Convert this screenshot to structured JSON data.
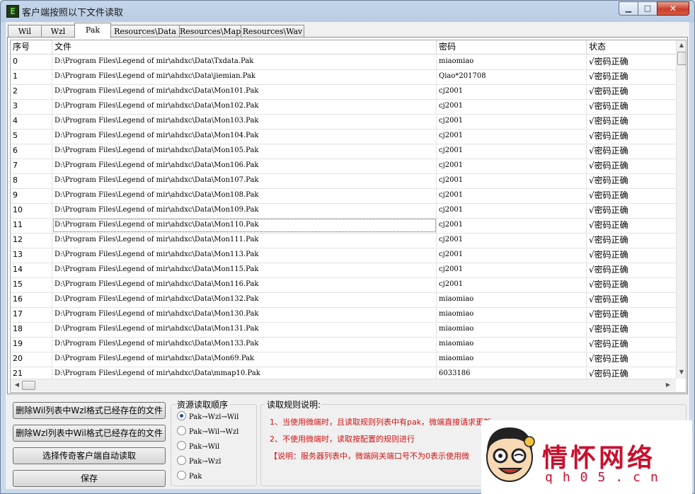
{
  "window": {
    "title": "客户端按照以下文件读取",
    "icon_letter": "E",
    "min_glyph": "▁",
    "max_glyph": "□",
    "close_glyph": "✕"
  },
  "tabs": [
    {
      "label": "Wil",
      "active": false
    },
    {
      "label": "Wzl",
      "active": false
    },
    {
      "label": "Pak",
      "active": true
    },
    {
      "label": "Resources\\Data",
      "active": false
    },
    {
      "label": "Resources\\Map",
      "active": false
    },
    {
      "label": "Resources\\Wav",
      "active": false
    }
  ],
  "table": {
    "columns": [
      "序号",
      "文件",
      "密码",
      "状态"
    ],
    "rows": [
      {
        "no": "0",
        "file": "D:\\Program Files\\Legend of mir\\ahdxc\\Data\\Txdata.Pak",
        "pwd": "miaomiao",
        "status": "√密码正确"
      },
      {
        "no": "1",
        "file": "D:\\Program Files\\Legend of mir\\ahdxc\\Data\\jiemian.Pak",
        "pwd": "Qiao*201708",
        "status": "√密码正确"
      },
      {
        "no": "2",
        "file": "D:\\Program Files\\Legend of mir\\ahdxc\\Data\\Mon101.Pak",
        "pwd": "cj2001",
        "status": "√密码正确"
      },
      {
        "no": "3",
        "file": "D:\\Program Files\\Legend of mir\\ahdxc\\Data\\Mon102.Pak",
        "pwd": "cj2001",
        "status": "√密码正确"
      },
      {
        "no": "4",
        "file": "D:\\Program Files\\Legend of mir\\ahdxc\\Data\\Mon103.Pak",
        "pwd": "cj2001",
        "status": "√密码正确"
      },
      {
        "no": "5",
        "file": "D:\\Program Files\\Legend of mir\\ahdxc\\Data\\Mon104.Pak",
        "pwd": "cj2001",
        "status": "√密码正确"
      },
      {
        "no": "6",
        "file": "D:\\Program Files\\Legend of mir\\ahdxc\\Data\\Mon105.Pak",
        "pwd": "cj2001",
        "status": "√密码正确"
      },
      {
        "no": "7",
        "file": "D:\\Program Files\\Legend of mir\\ahdxc\\Data\\Mon106.Pak",
        "pwd": "cj2001",
        "status": "√密码正确"
      },
      {
        "no": "8",
        "file": "D:\\Program Files\\Legend of mir\\ahdxc\\Data\\Mon107.Pak",
        "pwd": "cj2001",
        "status": "√密码正确"
      },
      {
        "no": "9",
        "file": "D:\\Program Files\\Legend of mir\\ahdxc\\Data\\Mon108.Pak",
        "pwd": "cj2001",
        "status": "√密码正确"
      },
      {
        "no": "10",
        "file": "D:\\Program Files\\Legend of mir\\ahdxc\\Data\\Mon109.Pak",
        "pwd": "cj2001",
        "status": "√密码正确"
      },
      {
        "no": "11",
        "file": "D:\\Program Files\\Legend of mir\\ahdxc\\Data\\Mon110.Pak",
        "pwd": "cj2001",
        "status": "√密码正确",
        "selected": true
      },
      {
        "no": "12",
        "file": "D:\\Program Files\\Legend of mir\\ahdxc\\Data\\Mon111.Pak",
        "pwd": "cj2001",
        "status": "√密码正确"
      },
      {
        "no": "13",
        "file": "D:\\Program Files\\Legend of mir\\ahdxc\\Data\\Mon113.Pak",
        "pwd": "cj2001",
        "status": "√密码正确"
      },
      {
        "no": "14",
        "file": "D:\\Program Files\\Legend of mir\\ahdxc\\Data\\Mon115.Pak",
        "pwd": "cj2001",
        "status": "√密码正确"
      },
      {
        "no": "15",
        "file": "D:\\Program Files\\Legend of mir\\ahdxc\\Data\\Mon116.Pak",
        "pwd": "cj2001",
        "status": "√密码正确"
      },
      {
        "no": "16",
        "file": "D:\\Program Files\\Legend of mir\\ahdxc\\Data\\Mon132.Pak",
        "pwd": "miaomiao",
        "status": "√密码正确"
      },
      {
        "no": "17",
        "file": "D:\\Program Files\\Legend of mir\\ahdxc\\Data\\Mon130.Pak",
        "pwd": "miaomiao",
        "status": "√密码正确"
      },
      {
        "no": "18",
        "file": "D:\\Program Files\\Legend of mir\\ahdxc\\Data\\Mon131.Pak",
        "pwd": "miaomiao",
        "status": "√密码正确"
      },
      {
        "no": "19",
        "file": "D:\\Program Files\\Legend of mir\\ahdxc\\Data\\Mon133.Pak",
        "pwd": "miaomiao",
        "status": "√密码正确"
      },
      {
        "no": "20",
        "file": "D:\\Program Files\\Legend of mir\\ahdxc\\Data\\Mon69.Pak",
        "pwd": "miaomiao",
        "status": "√密码正确"
      },
      {
        "no": "21",
        "file": "D:\\Program Files\\Legend of mir\\ahdxc\\Data\\mmap10.Pak",
        "pwd": "6033186",
        "status": "√密码正确"
      }
    ]
  },
  "buttons": {
    "delete_wil": "删除Wil列表中Wzl格式已经存在的文件",
    "delete_wzl": "删除Wzl列表中Wil格式已经存在的文件",
    "auto_read": "选择传奇客户端自动读取",
    "save": "保存"
  },
  "order_group": {
    "title": "资源读取顺序",
    "options": [
      {
        "label": "Pak→Wzl→Wil",
        "checked": true
      },
      {
        "label": "Pak→Wil→Wzl",
        "checked": false
      },
      {
        "label": "Pak→Wil",
        "checked": false
      },
      {
        "label": "Pak→Wzl",
        "checked": false
      },
      {
        "label": "Pak",
        "checked": false
      }
    ]
  },
  "rules": {
    "title": "读取规则说明:",
    "lines": [
      "1、当使用微端时，且读取规则列表中有pak，微端直接请求更新",
      "2、不使用微端时，读取按配置的规则进行",
      "【说明：服务器列表中，微端网关端口号不为0表示使用微"
    ]
  },
  "watermark": {
    "brand_cn": "情怀网络",
    "domain": "qh05.cn"
  },
  "colors": {
    "rule_text": "#d11212",
    "watermark": "#c8102e"
  }
}
